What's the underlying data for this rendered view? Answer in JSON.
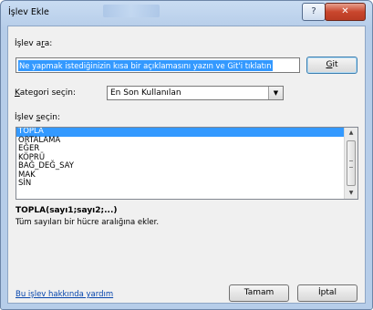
{
  "window": {
    "title": "İşlev Ekle",
    "help_glyph": "?",
    "close_glyph": "✕"
  },
  "search": {
    "label": "İşlev ara:",
    "value": "Ne yapmak istediğinizin kısa bir açıklamasını yazın ve Git'i tıklatın",
    "go_label": "Git"
  },
  "category": {
    "label": "Kategori seçin:",
    "selected": "En Son Kullanılan"
  },
  "function_list": {
    "label": "İşlev seçin:",
    "items": [
      "TOPLA",
      "ORTALAMA",
      "EĞER",
      "KÖPRÜ",
      "BAĞ_DEĞ_SAY",
      "MAK",
      "SİN"
    ],
    "selected_index": 0
  },
  "details": {
    "syntax": "TOPLA(sayı1;sayı2;...)",
    "description": "Tüm sayıları bir hücre aralığına ekler."
  },
  "footer": {
    "help_link": "Bu işlev hakkında yardım",
    "ok_label": "Tamam",
    "cancel_label": "İptal"
  },
  "colors": {
    "selection": "#3399ff",
    "link": "#0645ad",
    "close_button": "#c9462d"
  }
}
